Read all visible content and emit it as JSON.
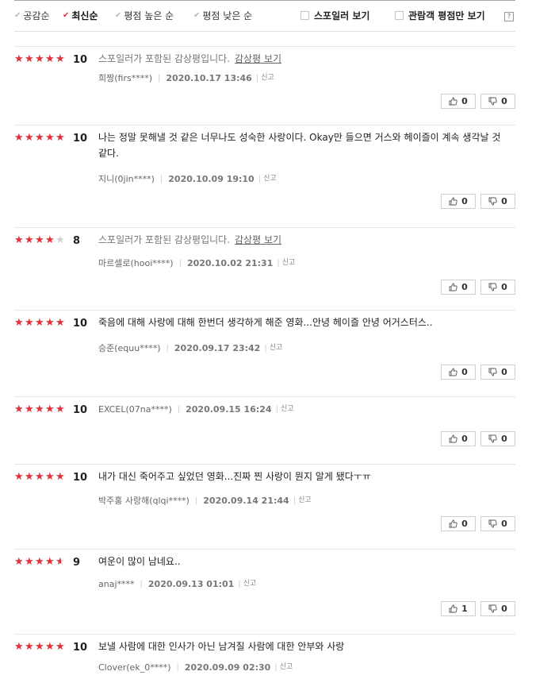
{
  "sort": [
    {
      "label": "공감순",
      "active": false
    },
    {
      "label": "최신순",
      "active": true
    },
    {
      "label": "평점 높은 순",
      "active": false
    },
    {
      "label": "평점 낮은 순",
      "active": false
    }
  ],
  "filters": {
    "spoiler_label": "스포일러 보기",
    "audience_label": "관람객 평점만 보기",
    "help_label": "?"
  },
  "colors": {
    "accent": "#e3303b",
    "star_empty": "#cfcfcf"
  },
  "reviews": [
    {
      "rating": 10,
      "score": "10",
      "text": "",
      "spoiler": true,
      "spoiler_text": "스포일러가 포함된 감상평입니다.",
      "spoiler_link": "감상평 보기",
      "user": "희짱(firs****)",
      "date": "2020.10.17 13:46",
      "report": "신고",
      "likes": "0",
      "dislikes": "0"
    },
    {
      "rating": 10,
      "score": "10",
      "text": "나는 정말 못해낼 것 같은 너무나도 성숙한 사랑이다. Okay만 들으면 거스와 헤이즐이 계속 생각날 것 같다.",
      "spoiler": false,
      "user": "지니(0jin****)",
      "date": "2020.10.09 19:10",
      "report": "신고",
      "likes": "0",
      "dislikes": "0"
    },
    {
      "rating": 8,
      "score": "8",
      "text": "",
      "spoiler": true,
      "spoiler_text": "스포일러가 포함된 감상평입니다.",
      "spoiler_link": "감상평 보기",
      "user": "마르셀로(hooi****)",
      "date": "2020.10.02 21:31",
      "report": "신고",
      "likes": "0",
      "dislikes": "0"
    },
    {
      "rating": 10,
      "score": "10",
      "text": "죽음에 대해 사랑에 대해 한번더 생각하게 해준 영화...안녕 헤이즐 안녕 어거스터스..",
      "spoiler": false,
      "user": "승준(equu****)",
      "date": "2020.09.17 23:42",
      "report": "신고",
      "likes": "0",
      "dislikes": "0"
    },
    {
      "rating": 10,
      "score": "10",
      "text": "",
      "spoiler": false,
      "user": "EXCEL(07na****)",
      "date": "2020.09.15 16:24",
      "report": "신고",
      "likes": "0",
      "dislikes": "0"
    },
    {
      "rating": 10,
      "score": "10",
      "text": "내가 대신 죽어주고 싶었던 영화...진짜 찐 사랑이 뭔지 알게 됐다ㅜㅠ",
      "spoiler": false,
      "user": "박주홍 사랑해(qlqi****)",
      "date": "2020.09.14 21:44",
      "report": "신고",
      "likes": "0",
      "dislikes": "0"
    },
    {
      "rating": 9,
      "score": "9",
      "text": "여운이 많이 남네요..",
      "spoiler": false,
      "user": "anaj****",
      "date": "2020.09.13 01:01",
      "report": "신고",
      "likes": "1",
      "dislikes": "0"
    },
    {
      "rating": 10,
      "score": "10",
      "text": "보낼 사람에 대한 인사가 아닌 남겨질 사람에 대한 안부와 사랑",
      "spoiler": false,
      "user": "Clover(ek_0****)",
      "date": "2020.09.09 02:30",
      "report": "신고",
      "likes": "",
      "dislikes": ""
    }
  ]
}
